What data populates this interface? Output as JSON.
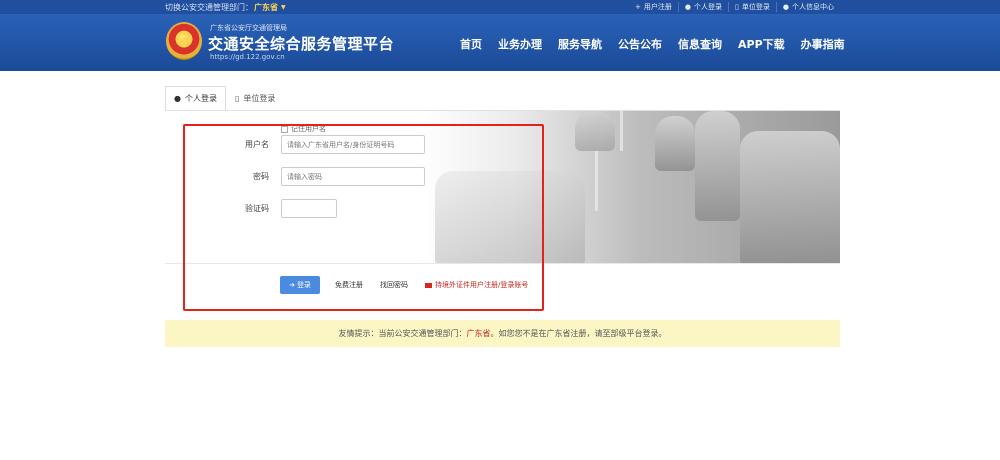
{
  "topbar": {
    "dept_label": "切换公安交通管理部门：",
    "dept_value": "广东省",
    "links": [
      {
        "icon": "plus-icon",
        "glyph": "+",
        "label": "用户注册"
      },
      {
        "icon": "user-icon",
        "glyph": "●",
        "label": "个人登录"
      },
      {
        "icon": "building-icon",
        "glyph": "▯",
        "label": "单位登录"
      },
      {
        "icon": "user-icon",
        "glyph": "●",
        "label": "个人信息中心"
      }
    ]
  },
  "header": {
    "subtitle": "广东省公安厅交通管理局",
    "title": "交通安全综合服务管理平台",
    "url": "https://gd.122.gov.cn",
    "nav": [
      "首页",
      "业务办理",
      "服务导航",
      "公告公布",
      "信息查询",
      "APP下载",
      "办事指南"
    ]
  },
  "tabs": [
    {
      "icon": "user-icon",
      "glyph": "●",
      "label": "个人登录",
      "active": true
    },
    {
      "icon": "building-icon",
      "glyph": "▯",
      "label": "单位登录",
      "active": false
    }
  ],
  "form": {
    "username_label": "用户名",
    "username_placeholder": "请输入广东省用户名/身份证明号码",
    "password_label": "密码",
    "password_placeholder": "请输入密码",
    "captcha_label": "验证码",
    "remember_label": "记住用户名"
  },
  "actions": {
    "login_label": "登录",
    "register_label": "免费注册",
    "forgot_label": "找回密码",
    "foreign_label": "持境外证件用户注册/登录账号"
  },
  "notice": {
    "prefix": "友情提示：当前公安交通管理部门：",
    "dept": "广东省",
    "suffix": "。如您您不是在广东省注册，请至部级平台登录。"
  },
  "colors": {
    "header_blue": "#1b4a98",
    "highlight_red": "#e2221c",
    "login_blue": "#4a8be0",
    "notice_bg": "#fcf6c5"
  }
}
